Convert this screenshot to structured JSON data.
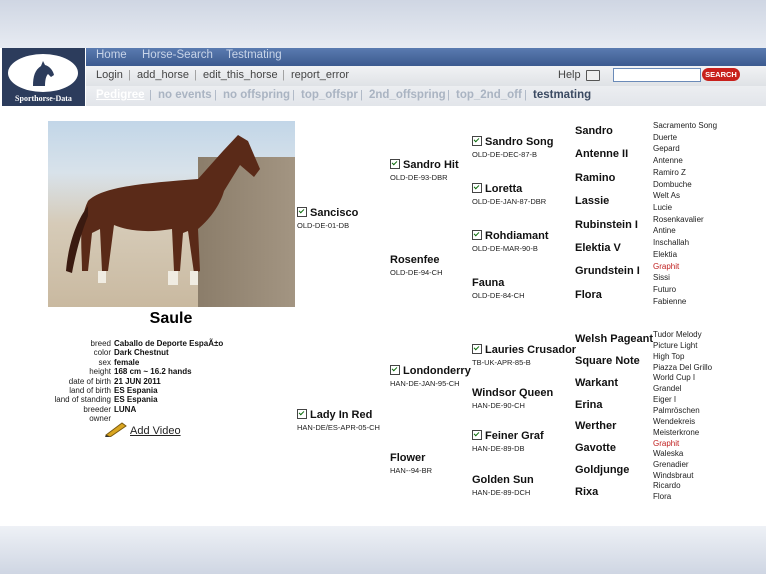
{
  "logo": {
    "text": "Sporthorse-Data"
  },
  "top_nav": [
    "Home",
    "Horse-Search",
    "Testmating"
  ],
  "sub_nav": [
    "Login",
    "add_horse",
    "edit_this_horse",
    "report_error"
  ],
  "help_label": "Help",
  "search": {
    "value": "",
    "button": "SEARCH"
  },
  "tabs": [
    "Pedigree",
    "no events",
    "no offspring",
    "top_offspr",
    "2nd_offspring",
    "top_2nd_off",
    "testmating"
  ],
  "horse": {
    "name": "Saule",
    "details": [
      {
        "label": "breed",
        "value": "Caballo de Deporte EspaÃ±o"
      },
      {
        "label": "color",
        "value": "Dark Chestnut"
      },
      {
        "label": "sex",
        "value": "female"
      },
      {
        "label": "height",
        "value": "168 cm ~ 16.2 hands"
      },
      {
        "label": "date of birth",
        "value": "21 JUN 2011"
      },
      {
        "label": "land of birth",
        "value": "ES Espania"
      },
      {
        "label": "land of standing",
        "value": "ES Espania"
      },
      {
        "label": "breeder",
        "value": "LUNA"
      },
      {
        "label": "owner",
        "value": ""
      }
    ],
    "video_label": "Add Video"
  },
  "pedigree": {
    "gen1": [
      {
        "name": "Sancisco",
        "reg": "OLD-DE-01-DB",
        "checked": true
      },
      {
        "name": "Lady In Red",
        "reg": "HAN-DE/ES-APR-05-CH",
        "checked": true
      }
    ],
    "gen2": [
      {
        "name": "Sandro Hit",
        "reg": "OLD-DE-93-DBR",
        "checked": true
      },
      {
        "name": "Rosenfee",
        "reg": "OLD-DE-94-CH",
        "checked": false
      },
      {
        "name": "Londonderry",
        "reg": "HAN-DE-JAN-95-CH",
        "checked": true
      },
      {
        "name": "Flower",
        "reg": "HAN--94-BR",
        "checked": false
      }
    ],
    "gen3": [
      {
        "name": "Sandro Song",
        "reg": "OLD-DE-DEC-87-B",
        "checked": true
      },
      {
        "name": "Loretta",
        "reg": "OLD-DE-JAN-87-DBR",
        "checked": true
      },
      {
        "name": "Rohdiamant",
        "reg": "OLD-DE-MAR-90-B",
        "checked": true
      },
      {
        "name": "Fauna",
        "reg": "OLD-DE-84-CH",
        "checked": false
      },
      {
        "name": "Lauries Crusador",
        "reg": "TB-UK-APR-85-B",
        "checked": true
      },
      {
        "name": "Windsor Queen",
        "reg": "HAN-DE-90-CH",
        "checked": false
      },
      {
        "name": "Feiner Graf",
        "reg": "HAN-DE-89-DB",
        "checked": true
      },
      {
        "name": "Golden Sun",
        "reg": "HAN-DE-89-DCH",
        "checked": false
      }
    ],
    "gen4": [
      "Sandro",
      "Antenne II",
      "Ramino",
      "Lassie",
      "Rubinstein I",
      "Elektia V",
      "Grundstein I",
      "Flora",
      "Welsh Pageant",
      "Square Note",
      "Warkant",
      "Erina",
      "Werther",
      "Gavotte",
      "Goldjunge",
      "Rixa"
    ],
    "gen5": [
      {
        "name": "Sacramento Song",
        "red": false
      },
      {
        "name": "Duerte",
        "red": false
      },
      {
        "name": "Gepard",
        "red": false
      },
      {
        "name": "Antenne",
        "red": false
      },
      {
        "name": "Ramiro Z",
        "red": false
      },
      {
        "name": "Dombuche",
        "red": false
      },
      {
        "name": "Welt As",
        "red": false
      },
      {
        "name": "Lucie",
        "red": false
      },
      {
        "name": "Rosenkavalier",
        "red": false
      },
      {
        "name": "Antine",
        "red": false
      },
      {
        "name": "Inschallah",
        "red": false
      },
      {
        "name": "Elektia",
        "red": false
      },
      {
        "name": "Graphit",
        "red": true
      },
      {
        "name": "Sissi",
        "red": false
      },
      {
        "name": "Futuro",
        "red": false
      },
      {
        "name": "Fabienne",
        "red": false
      },
      {
        "name": "Tudor Melody",
        "red": false
      },
      {
        "name": "Picture Light",
        "red": false
      },
      {
        "name": "High Top",
        "red": false
      },
      {
        "name": "Piazza Del Grillo",
        "red": false
      },
      {
        "name": "World Cup I",
        "red": false
      },
      {
        "name": "Grandel",
        "red": false
      },
      {
        "name": "Eiger I",
        "red": false
      },
      {
        "name": "Palmröschen",
        "red": false
      },
      {
        "name": "Wendekreis",
        "red": false
      },
      {
        "name": "Meisterkrone",
        "red": false
      },
      {
        "name": "Graphit",
        "red": true
      },
      {
        "name": "Waleska",
        "red": false
      },
      {
        "name": "Grenadier",
        "red": false
      },
      {
        "name": "Windsbraut",
        "red": false
      },
      {
        "name": "Ricardo",
        "red": false
      },
      {
        "name": "Flora",
        "red": false
      }
    ]
  }
}
